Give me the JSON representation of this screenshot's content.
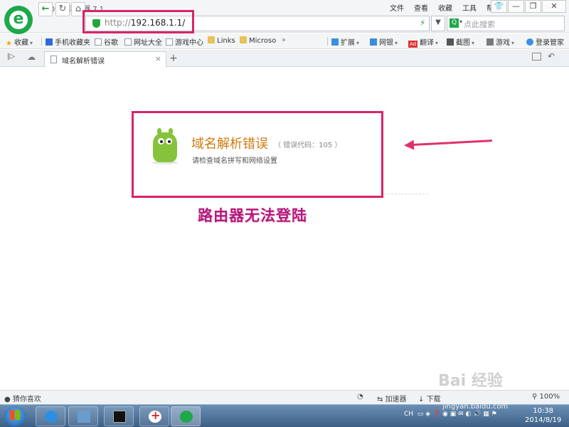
{
  "window": {
    "title": "360安全浏览器 7.1"
  },
  "menu": [
    "文件",
    "查看",
    "收藏",
    "工具",
    "帮助"
  ],
  "window_controls": {
    "shirt": "👕",
    "minimize": "—",
    "restore": "❐",
    "close": "✕"
  },
  "address": {
    "protocol": "http://",
    "host": "192.168.1.1/"
  },
  "search": {
    "placeholder": "点此搜索"
  },
  "bookmarks": {
    "left": [
      {
        "label": "收藏",
        "icon": "star-icon"
      },
      {
        "label": "手机收藏夹",
        "icon": "phone-icon"
      },
      {
        "label": "谷歌",
        "icon": "page-icon"
      },
      {
        "label": "网址大全",
        "icon": "page-icon"
      },
      {
        "label": "游戏中心",
        "icon": "page-icon"
      },
      {
        "label": "Links",
        "icon": "folder-icon"
      },
      {
        "label": "Microso",
        "icon": "folder-icon"
      }
    ],
    "more": "»",
    "right": [
      {
        "label": "扩展",
        "icon": "puzzle-icon"
      },
      {
        "label": "网银",
        "icon": "bank-icon"
      },
      {
        "label": "翻译",
        "icon": "translate-icon"
      },
      {
        "label": "截图",
        "icon": "scissors-icon"
      },
      {
        "label": "游戏",
        "icon": "game-icon"
      },
      {
        "label": "登录管家",
        "icon": "login-icon"
      }
    ]
  },
  "tabs": [
    {
      "label": "域名解析错误",
      "active": true
    }
  ],
  "error_page": {
    "title": "域名解析错误",
    "code": "（ 错误代码：105 ）",
    "hint": "请检查域名拼写和网络设置"
  },
  "annotation": {
    "caption": "路由器无法登陆",
    "color": "#d8246a"
  },
  "statusbar": {
    "left": "猜你喜欢",
    "accelerator": "加速器",
    "download": "下载",
    "zoom": "100%"
  },
  "watermark": {
    "text": "Bai 经验",
    "url": "jingyan.baidu.com"
  },
  "taskbar": {
    "tray_lang": "CH",
    "time": "10:38",
    "date": "2014/8/19"
  }
}
